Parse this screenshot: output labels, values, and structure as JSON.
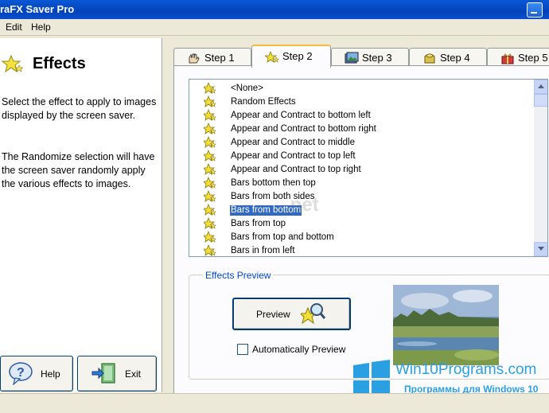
{
  "window": {
    "title": "raFX Saver Pro"
  },
  "menu": {
    "edit": "Edit",
    "help": "Help"
  },
  "left_panel": {
    "heading": "Effects",
    "description": "Select the effect to apply to images displayed by the screen saver.",
    "randomize_note": "The Randomize selection will have the screen saver randomly apply the various effects to images.",
    "help_button": "Help",
    "exit_button": "Exit"
  },
  "tabs": [
    {
      "label": "Step 1",
      "icon": "hand-icon"
    },
    {
      "label": "Step 2",
      "icon": "stars-icon",
      "active": true
    },
    {
      "label": "Step 3",
      "icon": "images-icon"
    },
    {
      "label": "Step 4",
      "icon": "bag-icon"
    },
    {
      "label": "Step 5",
      "icon": "gift-icon"
    }
  ],
  "effects_list": {
    "items": [
      "<None>",
      "Random Effects",
      "Appear and Contract to bottom left",
      "Appear and Contract to bottom right",
      "Appear and Contract to middle",
      "Appear and Contract to top left",
      "Appear and Contract to top right",
      "Bars bottom then top",
      "Bars from both sides",
      "Bars from bottom",
      "Bars from top",
      "Bars from top and bottom",
      "Bars in from left"
    ],
    "selected": "Bars from bottom"
  },
  "effects_preview": {
    "legend": "Effects Preview",
    "preview_button": "Preview",
    "auto_preview_label": "Automatically Preview",
    "auto_preview_checked": false
  },
  "overlay": {
    "watermark": ".net",
    "site": "Win10Programs.com",
    "tagline": "Программы для Windows 10"
  },
  "colors": {
    "titlebar": "#0343b8",
    "selection": "#316ac5",
    "tab_highlight": "#f8b93f",
    "group_legend": "#0046d5",
    "logo": "#2aa0e3"
  }
}
